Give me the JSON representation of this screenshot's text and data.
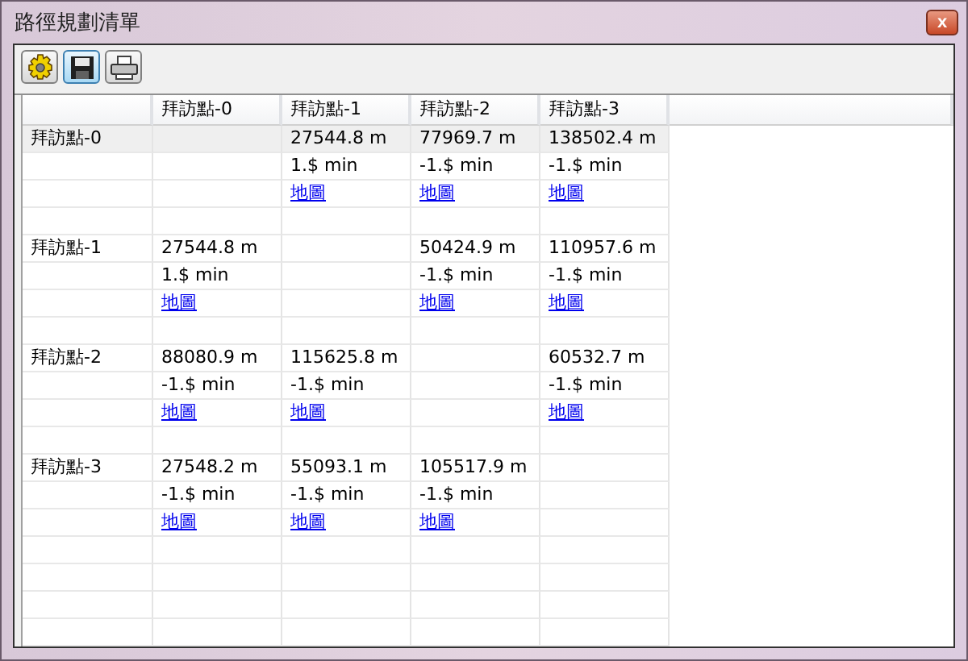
{
  "window": {
    "title": "路徑規劃清單",
    "close": "x"
  },
  "toolbar": [
    {
      "kind": "settings",
      "active": false
    },
    {
      "kind": "save",
      "active": true
    },
    {
      "kind": "print",
      "active": false
    }
  ],
  "table": {
    "columns": [
      "拜訪點-0",
      "拜訪點-1",
      "拜訪點-2",
      "拜訪點-3"
    ],
    "rows": [
      {
        "label": "拜訪點-0",
        "selected": true,
        "cells": [
          {
            "kind": "self"
          },
          {
            "kind": "route",
            "distance": "27544.8 m",
            "time": "1.$ min",
            "link": "地圖"
          },
          {
            "kind": "route",
            "distance": "77969.7 m",
            "time": "-1.$ min",
            "link": "地圖"
          },
          {
            "kind": "route",
            "distance": "138502.4 m",
            "time": "-1.$ min",
            "link": "地圖"
          }
        ]
      },
      {
        "label": "拜訪點-1",
        "selected": false,
        "cells": [
          {
            "kind": "route",
            "distance": "27544.8 m",
            "time": "1.$ min",
            "link": "地圖"
          },
          {
            "kind": "self"
          },
          {
            "kind": "route",
            "distance": "50424.9 m",
            "time": "-1.$ min",
            "link": "地圖"
          },
          {
            "kind": "route",
            "distance": "110957.6 m",
            "time": "-1.$ min",
            "link": "地圖"
          }
        ]
      },
      {
        "label": "拜訪點-2",
        "selected": false,
        "cells": [
          {
            "kind": "route",
            "distance": "88080.9 m",
            "time": "-1.$ min",
            "link": "地圖"
          },
          {
            "kind": "route",
            "distance": "115625.8 m",
            "time": "-1.$ min",
            "link": "地圖"
          },
          {
            "kind": "self"
          },
          {
            "kind": "route",
            "distance": "60532.7 m",
            "time": "-1.$ min",
            "link": "地圖"
          }
        ]
      },
      {
        "label": "拜訪點-3",
        "selected": false,
        "cells": [
          {
            "kind": "route",
            "distance": "27548.2 m",
            "time": "-1.$ min",
            "link": "地圖"
          },
          {
            "kind": "route",
            "distance": "55093.1 m",
            "time": "-1.$ min",
            "link": "地圖"
          },
          {
            "kind": "route",
            "distance": "105517.9 m",
            "time": "-1.$ min",
            "link": "地圖"
          },
          {
            "kind": "self"
          }
        ]
      }
    ]
  }
}
